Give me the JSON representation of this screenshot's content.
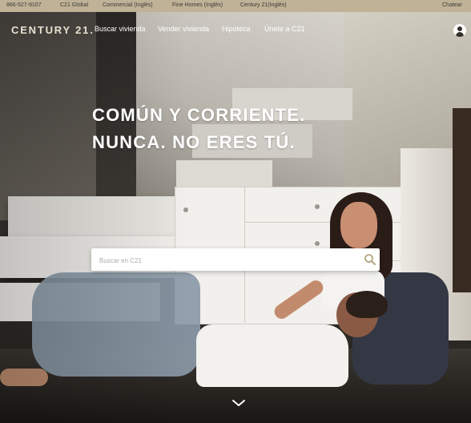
{
  "topbar": {
    "phone": "866-527-9107",
    "links": [
      "C21 Global",
      "Commercial (Inglés)",
      "Fine Homes (Inglés)",
      "Century 21(Inglés)"
    ],
    "right_label": "Chatear"
  },
  "header": {
    "logo": "CENTURY 21.",
    "nav": [
      "Buscar vivienda",
      "Vender vivienda",
      "Hipoteca",
      "Únete a C21"
    ],
    "user_icon": "user-icon"
  },
  "hero": {
    "line1": "COMÚN Y CORRIENTE.",
    "line2": "NUNCA. NO ERES TÚ."
  },
  "search": {
    "placeholder": "Buscar en C21",
    "icon": "search-icon"
  },
  "scroll": {
    "icon": "chevron-down-icon"
  },
  "colors": {
    "topbar_bg": "#bfb297",
    "logo_gold": "#e9e1cf",
    "search_icon": "#b6a67f"
  }
}
